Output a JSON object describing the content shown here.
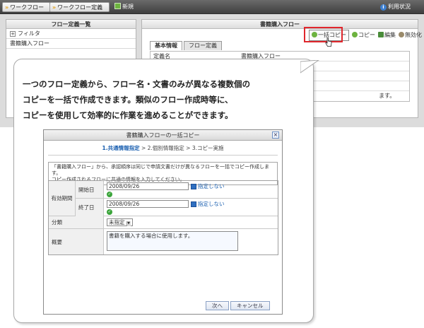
{
  "topbar": {
    "breadcrumbs": [
      "ワークフロー",
      "ワークフロー定義"
    ],
    "new_label": "新規",
    "usage_label": "利用状況"
  },
  "left_panel": {
    "title": "フロー定義一覧",
    "filter_label": "フィルタ",
    "items": [
      "書籍購入フロー"
    ]
  },
  "right_panel": {
    "title": "書籍購入フロー",
    "toolbar": {
      "bulk_copy": "一括コピー",
      "copy": "コピー",
      "edit": "編集",
      "disable": "無効化"
    },
    "tabs": [
      "基本情報",
      "フロー定義"
    ],
    "rows": [
      {
        "key": "定義名",
        "value": "書籍購入フロー"
      },
      {
        "key": "",
        "value": ""
      },
      {
        "key": "",
        "value": ""
      },
      {
        "key": "",
        "value": ""
      },
      {
        "key": "",
        "value": "ます。"
      }
    ]
  },
  "callout": {
    "lines": [
      "一つのフロー定義から、フロー名・文書のみが異なる複数個の",
      "コピーを一括で作成できます。類似のフロー作成時等に、",
      "コピーを使用して効率的に作業を進めることができます。"
    ]
  },
  "dialog": {
    "title": "書籍購入フローの一括コピー",
    "steps": {
      "current": "1.共通情報指定",
      "rest": " > 2.個別情報指定 > 3.コピー実施"
    },
    "notice_lines": [
      "「書籍購入フロー」から、承認順序は同じで申請文書だけが異なるフローを一括でコピー作成します。",
      "コピー作成されるフローに共通の情報を入力してください。"
    ],
    "validity_label": "有効期間",
    "start_label": "開始日",
    "start_value": "2008/09/26",
    "end_label": "終了日",
    "end_value": "2008/09/26",
    "no_limit": "指定しない",
    "category_label": "分類",
    "category_value": "未指定",
    "summary_label": "概要",
    "summary_value": "書籍を購入する場合に使用します。",
    "next_button": "次へ",
    "cancel_button": "キャンセル"
  },
  "colors": {
    "highlight": "#e0262c",
    "link": "#1a5fb0",
    "check": "#3aa43a"
  }
}
